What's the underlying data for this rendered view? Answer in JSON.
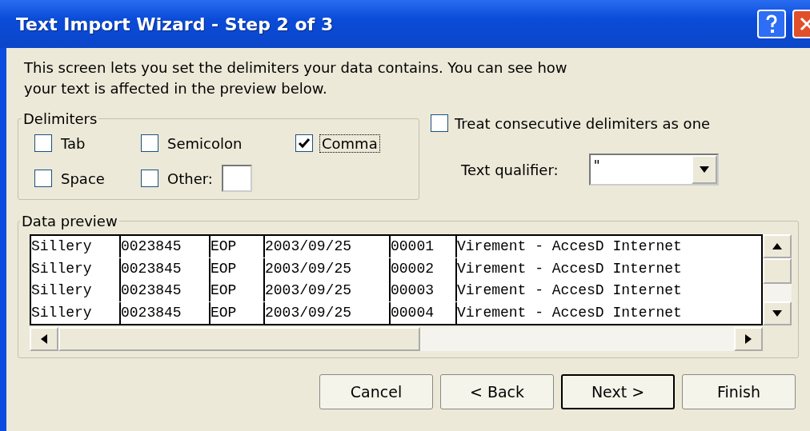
{
  "window": {
    "title": "Text Import Wizard - Step 2 of 3"
  },
  "intro": "This screen lets you set the delimiters your data contains.  You can see how your text is affected in the preview below.",
  "delimiters": {
    "legend": "Delimiters",
    "options": [
      {
        "label": "Tab",
        "checked": false,
        "kind": "check"
      },
      {
        "label": "Semicolon",
        "checked": false,
        "kind": "check"
      },
      {
        "label": "Comma",
        "checked": true,
        "focused": true,
        "kind": "check"
      },
      {
        "label": "Space",
        "checked": false,
        "kind": "check"
      },
      {
        "label": "Other:",
        "checked": false,
        "kind": "other"
      }
    ]
  },
  "consecutive": {
    "label": "Treat consecutive delimiters as one",
    "checked": false
  },
  "qualifier": {
    "label": "Text qualifier:",
    "value": "\""
  },
  "preview": {
    "legend": "Data preview",
    "rows": [
      [
        "Sillery",
        "0023845",
        "EOP",
        "2003/09/25",
        "00001",
        "Virement - AccesD Internet"
      ],
      [
        "Sillery",
        "0023845",
        "EOP",
        "2003/09/25",
        "00002",
        "Virement - AccesD Internet"
      ],
      [
        "Sillery",
        "0023845",
        "EOP",
        "2003/09/25",
        "00003",
        "Virement - AccesD Internet"
      ],
      [
        "Sillery",
        "0023845",
        "EOP",
        "2003/09/25",
        "00004",
        "Virement - AccesD Internet"
      ]
    ]
  },
  "buttons": [
    {
      "label": "Cancel",
      "default": false
    },
    {
      "label": "< Back",
      "default": false
    },
    {
      "label": "Next >",
      "default": true
    },
    {
      "label": "Finish",
      "default": false
    }
  ]
}
